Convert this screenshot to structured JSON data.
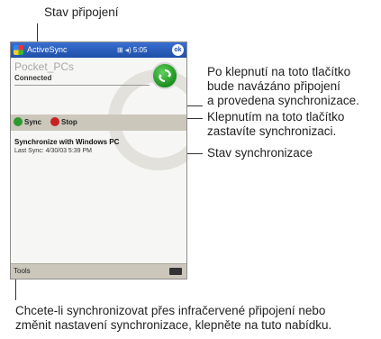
{
  "callouts": {
    "connection_status": "Stav připojení",
    "sync_button": [
      "Po klepnutí na toto tlačítko",
      "bude navázáno připojení",
      "a provedena synchronizace."
    ],
    "stop_button": [
      "Klepnutím na toto tlačítko",
      "zastavíte synchronizaci."
    ],
    "sync_status": "Stav synchronizace",
    "tools_menu": [
      "Chcete-li synchronizovat přes infračervené připojení nebo",
      "změnit nastavení synchronizace, klepněte na tuto nabídku."
    ]
  },
  "device": {
    "title": "ActiveSync",
    "status_icons": "⊞ ◂) 5:05",
    "ok": "ok",
    "device_name": "Pocket_PCs",
    "connection": "Connected",
    "sync_label": "Sync",
    "stop_label": "Stop",
    "status_title": "Synchronize with Windows PC",
    "status_detail": "Last Sync: 4/30/03 5:39 PM",
    "menu_tools": "Tools"
  },
  "colors": {
    "titlebar": "#1e4fa8",
    "sync_green": "#2c9a2c",
    "stop_red": "#c62222",
    "bar_gray": "#cbc7bb"
  }
}
